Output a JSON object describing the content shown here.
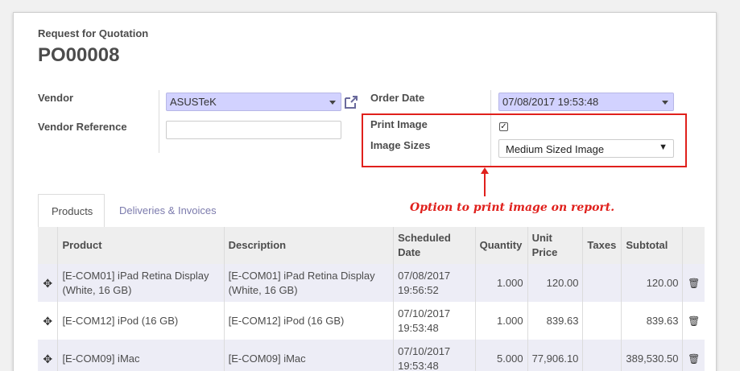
{
  "form": {
    "doc_type": "Request for Quotation",
    "doc_name": "PO00008"
  },
  "fields": {
    "vendor_label": "Vendor",
    "vendor_value": "ASUSTeK",
    "vendor_ref_label": "Vendor Reference",
    "vendor_ref_value": "",
    "order_date_label": "Order Date",
    "order_date_value": "07/08/2017 19:53:48",
    "print_image_label": "Print Image",
    "print_image_checked": true,
    "image_sizes_label": "Image Sizes",
    "image_sizes_value": "Medium Sized Image"
  },
  "annotation": {
    "text": "Option to print image on report.",
    "color": "#e0201c"
  },
  "tabs": [
    {
      "label": "Products",
      "active": true
    },
    {
      "label": "Deliveries & Invoices",
      "active": false
    }
  ],
  "table": {
    "headers": {
      "product": "Product",
      "description": "Description",
      "scheduled_1": "Scheduled",
      "scheduled_2": "Date",
      "quantity": "Quantity",
      "unit_price_1": "Unit",
      "unit_price_2": "Price",
      "taxes": "Taxes",
      "subtotal": "Subtotal"
    },
    "rows": [
      {
        "product": "[E-COM01] iPad Retina Display (White, 16 GB)",
        "description": "[E-COM01] iPad Retina Display (White, 16 GB)",
        "date": "07/08/2017",
        "time": "19:56:52",
        "quantity": "1.000",
        "unit_price": "120.00",
        "taxes": "",
        "subtotal": "120.00"
      },
      {
        "product": "[E-COM12] iPod (16 GB)",
        "description": "[E-COM12] iPod (16 GB)",
        "date": "07/10/2017",
        "time": "19:53:48",
        "quantity": "1.000",
        "unit_price": "839.63",
        "taxes": "",
        "subtotal": "839.63"
      },
      {
        "product": "[E-COM09] iMac",
        "description": "[E-COM09] iMac",
        "date": "07/10/2017",
        "time": "19:53:48",
        "quantity": "5.000",
        "unit_price": "77,906.10",
        "taxes": "",
        "subtotal": "389,530.50"
      }
    ]
  },
  "icons": {
    "external_link": "external-link-icon",
    "drag_handle": "drag-handle-icon",
    "trash": "trash-icon"
  }
}
